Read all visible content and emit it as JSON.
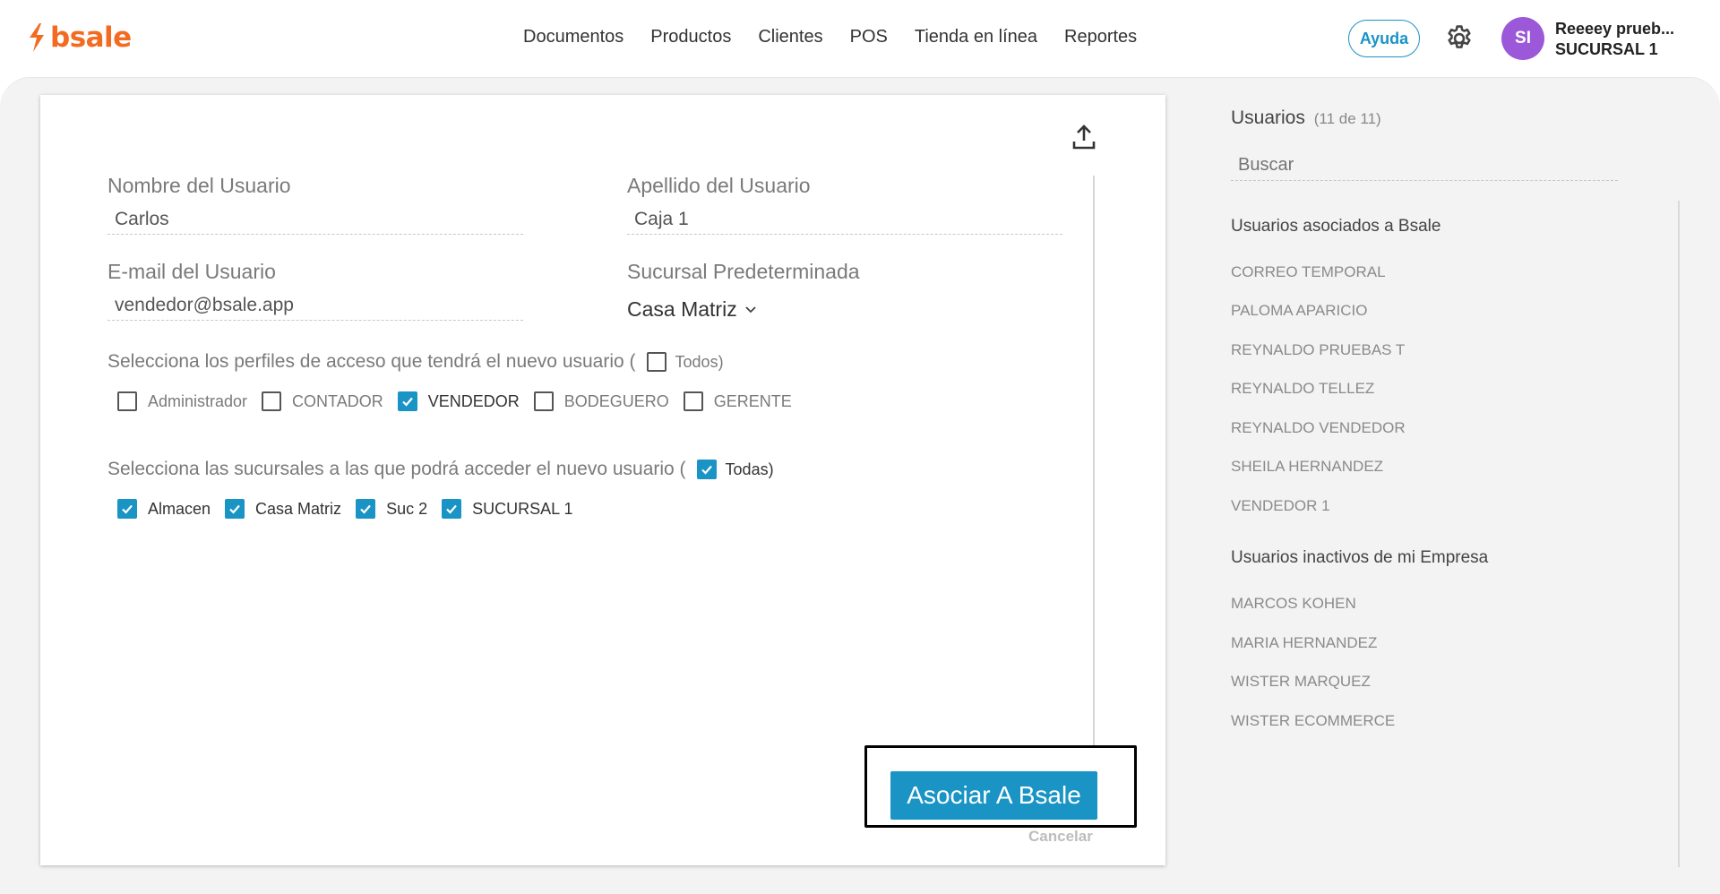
{
  "header": {
    "brand": "bsale",
    "nav": [
      "Documentos",
      "Productos",
      "Clientes",
      "POS",
      "Tienda en línea",
      "Reportes"
    ],
    "help_label": "Ayuda",
    "avatar_initials": "SI",
    "user_name": "Reeeey prueb...",
    "user_branch": "SUCURSAL 1",
    "accent_color": "#f26b21"
  },
  "form": {
    "first_name_label": "Nombre del Usuario",
    "first_name_value": "Carlos",
    "last_name_label": "Apellido del Usuario",
    "last_name_value": "Caja 1",
    "email_label": "E-mail del Usuario",
    "email_value": "vendedor@bsale.app",
    "branch_label": "Sucursal Predeterminada",
    "branch_value": "Casa Matriz",
    "profiles_prompt": "Selecciona los perfiles de acceso que tendrá el nuevo usuario (",
    "profiles_all_label": "Todos)",
    "profiles_all_checked": false,
    "profiles": [
      {
        "label": "Administrador",
        "checked": false
      },
      {
        "label": "CONTADOR",
        "checked": false
      },
      {
        "label": "VENDEDOR",
        "checked": true
      },
      {
        "label": "BODEGUERO",
        "checked": false
      },
      {
        "label": "GERENTE",
        "checked": false
      }
    ],
    "branches_prompt": "Selecciona las sucursales a las que podrá acceder el nuevo usuario (",
    "branches_all_label": "Todas)",
    "branches_all_checked": true,
    "branches": [
      {
        "label": "Almacen",
        "checked": true
      },
      {
        "label": "Casa Matriz",
        "checked": true
      },
      {
        "label": "Suc 2",
        "checked": true
      },
      {
        "label": "SUCURSAL 1",
        "checked": true
      }
    ],
    "submit_label": "Asociar A Bsale",
    "cancel_label": "Cancelar",
    "primary_color": "#1a94c4"
  },
  "sidebar": {
    "title": "Usuarios",
    "count": "(11 de 11)",
    "search_placeholder": "Buscar",
    "associated_title": "Usuarios asociados a Bsale",
    "associated": [
      "CORREO TEMPORAL",
      "PALOMA APARICIO",
      "REYNALDO PRUEBAS T",
      "REYNALDO TELLEZ",
      "REYNALDO VENDEDOR",
      "SHEILA HERNANDEZ",
      "VENDEDOR 1"
    ],
    "inactive_title": "Usuarios inactivos de mi Empresa",
    "inactive": [
      "MARCOS KOHEN",
      "MARIA HERNANDEZ",
      "WISTER MARQUEZ",
      "WISTER ECOMMERCE"
    ]
  }
}
